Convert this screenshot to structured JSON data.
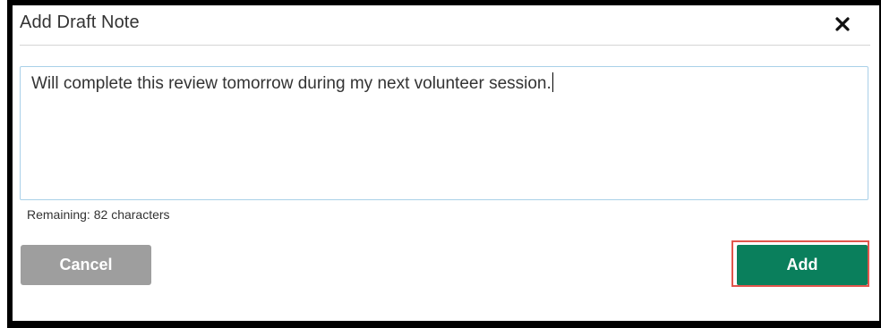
{
  "dialog": {
    "title": "Add Draft Note",
    "close_icon": "close-icon",
    "note": {
      "value": "Will complete this review tomorrow during my next volunteer session."
    },
    "remaining": {
      "label": "Remaining:",
      "count": "82",
      "unit": "characters"
    },
    "buttons": {
      "cancel_label": "Cancel",
      "add_label": "Add"
    },
    "colors": {
      "add_button": "#0a7f5c",
      "cancel_button": "#9e9e9e",
      "highlight_outline": "#e2554c",
      "textarea_border": "#a9d0e8"
    }
  }
}
